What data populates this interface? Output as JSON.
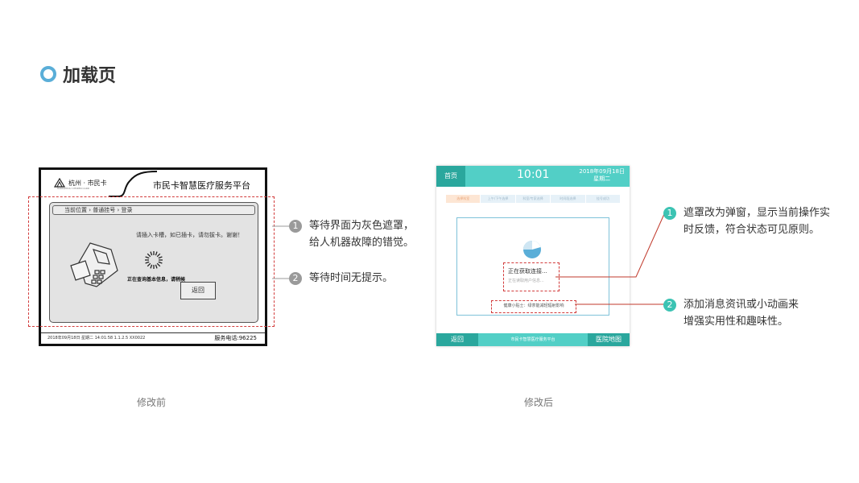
{
  "page": {
    "title": "加载页"
  },
  "before": {
    "logo_text": "杭州 · 市民卡",
    "logo_sub": "HANGZHOU CITIZEN CARD",
    "platform_title": "市民卡智慧医疗服务平台",
    "breadcrumb": "当前位置 › 普通挂号 › 登录",
    "insert_tip": "请插入卡槽，如已插卡，请勿拔卡。谢谢！",
    "query_text": "正在查询基本信息，请稍候",
    "back_button": "返回",
    "footer_info": "2018年09月18日  星期二  14:01:58    1.1.2.5    XX0022",
    "service_phone": "服务电话:96225",
    "caption": "修改前"
  },
  "after": {
    "home_button": "首页",
    "time": "10:01",
    "date": "2018年09月18日",
    "weekday": "星期二",
    "steps": [
      "选择科室",
      "上午/下午选择",
      "科室/专家选择",
      "时间段选择",
      "挂号成功"
    ],
    "active_step_index": 0,
    "status_main": "正在获取连接...",
    "status_sub": "正在读取用户信息...",
    "health_tip": "健康小贴士：绿茶能减轻辐射影响",
    "footer_back": "返回",
    "footer_title": "市民卡智慧医疗服务平台",
    "footer_map": "医院地图",
    "caption": "修改后"
  },
  "notes_before": [
    {
      "number": "1",
      "lines": [
        "等待界面为灰色遮罩，",
        "给人机器故障的错觉。"
      ]
    },
    {
      "number": "2",
      "lines": [
        "等待时间无提示。"
      ]
    }
  ],
  "notes_after": [
    {
      "number": "1",
      "lines": [
        "遮罩改为弹窗，显示当前操作实",
        "时反馈，符合状态可见原则。"
      ]
    },
    {
      "number": "2",
      "lines": [
        "添加消息资讯或小动画来",
        "增强实用性和趣味性。"
      ]
    }
  ],
  "colors": {
    "accent_blue": "#5aaed8",
    "teal": "#52cfc6",
    "teal_dark": "#2aa79d",
    "badge_teal": "#3cc3b3",
    "dashed_red": "#d23b3b"
  }
}
